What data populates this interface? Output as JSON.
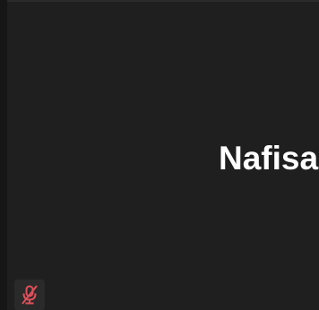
{
  "participant": {
    "name": "Nafisa"
  },
  "status": {
    "mic_icon": "mic-muted-icon",
    "mic_state": "muted"
  },
  "colors": {
    "background": "#1f1f1f",
    "name_text": "#ffffff",
    "muted_indicator": "#e0505a"
  }
}
